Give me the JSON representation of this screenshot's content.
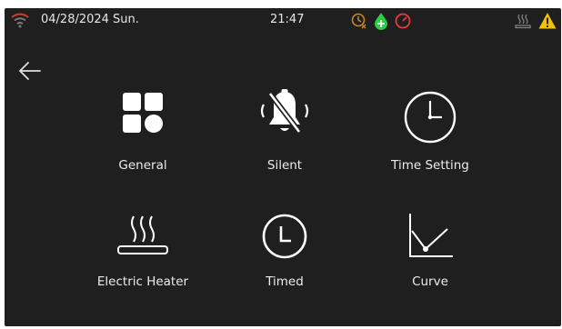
{
  "status": {
    "date": "04/28/2024 Sun.",
    "time": "21:47"
  },
  "menu": [
    {
      "label": "General",
      "icon": "general-grid-icon"
    },
    {
      "label": "Silent",
      "icon": "bell-off-icon"
    },
    {
      "label": "Time Setting",
      "icon": "clock-icon"
    },
    {
      "label": "Electric Heater",
      "icon": "heater-icon"
    },
    {
      "label": "Timed",
      "icon": "timer-icon"
    },
    {
      "label": "Curve",
      "icon": "curve-chart-icon"
    }
  ],
  "colors": {
    "background": "#1f1f1f",
    "text": "#e8e8e8",
    "warning": "#f2c200",
    "green_status": "#2ecc40",
    "red_status": "#e23b3b",
    "amber_status": "#c8862a"
  }
}
